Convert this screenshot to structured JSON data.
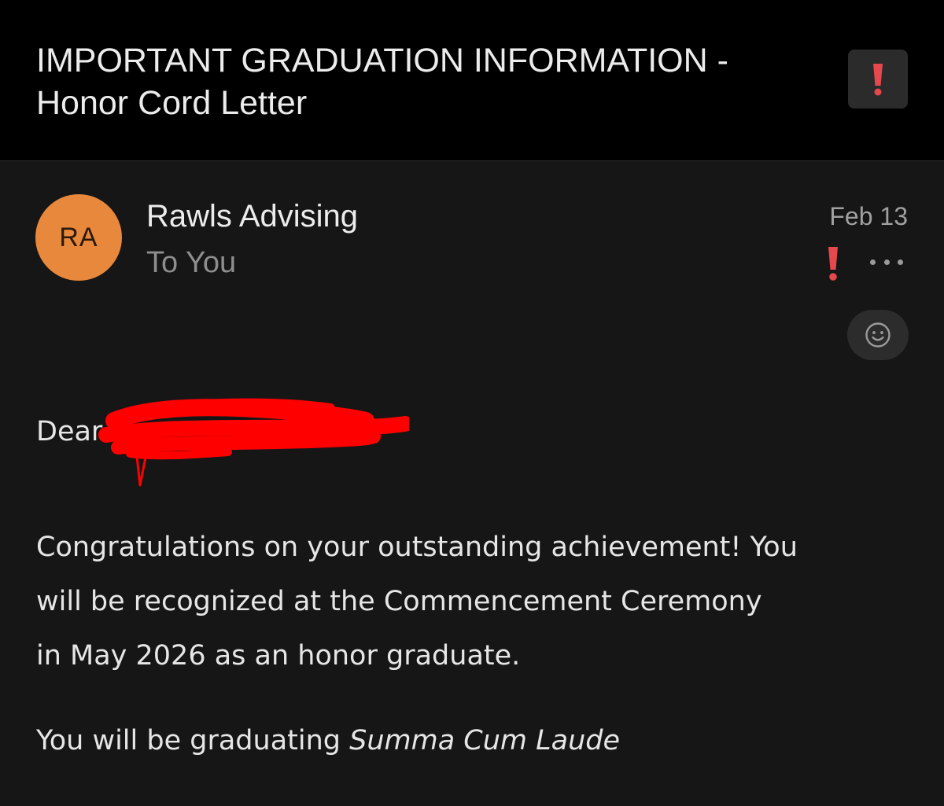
{
  "header": {
    "subject_line1": "IMPORTANT GRADUATION INFORMATION -",
    "subject_line2": "Honor Cord Letter",
    "importance_icon": "exclamation-icon",
    "importance_color": "#e5484d"
  },
  "message": {
    "avatar_initials": "RA",
    "avatar_color": "#e7883c",
    "sender_name": "Rawls Advising",
    "recipient": "To You",
    "date": "Feb 13",
    "flag_icon": "exclamation-icon",
    "more_icon": "ellipsis-icon",
    "reaction_icon": "smiley-icon"
  },
  "body": {
    "greeting": "Dear",
    "paragraph1_line1": "Congratulations on your outstanding achievement! You",
    "paragraph1_line2": "will be recognized at the Commencement Ceremony",
    "paragraph1_line3": "in May 2026 as an honor graduate.",
    "paragraph2_prefix": "You will be graduating ",
    "paragraph2_honor": "Summa Cum Laude",
    "redaction_color": "#ff0000"
  }
}
